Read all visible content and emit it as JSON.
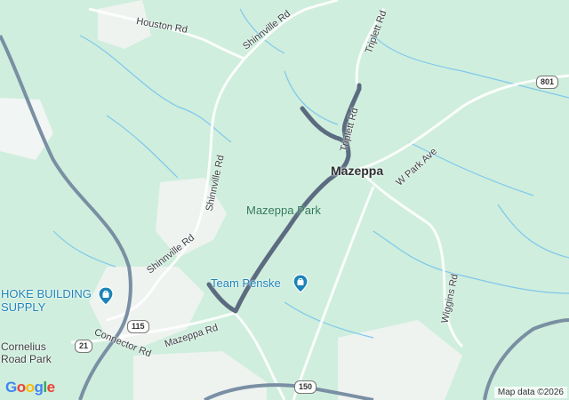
{
  "map": {
    "places": {
      "mazeppa": "Mazeppa",
      "mazeppa_park": "Mazeppa Park",
      "cornelius_road_park": "Cornelius Road Park"
    },
    "pois": {
      "team_penske": "Team Penske",
      "hoke_building_supply": "HOKE BUILDING SUPPLY"
    },
    "roads": {
      "houston_rd": "Houston Rd",
      "shinnville_rd_top": "Shinnville Rd",
      "triplett_rd_top": "Triplett Rd",
      "triplett_rd_mid": "Triplett Rd",
      "shinnville_rd_mid": "Shinnville Rd",
      "shinnville_rd_low": "Shinnville Rd",
      "w_park_ave": "W Park Ave",
      "wiggins_rd": "Wiggins Rd",
      "mazeppa_rd": "Mazeppa Rd",
      "connector_rd": "Connector Rd"
    },
    "shields": {
      "route_801": "801",
      "route_115": "115",
      "route_21": "21",
      "route_150": "150"
    },
    "colors": {
      "land": "#cfeedd",
      "route": "#5b6b80",
      "water": "#7ec8ec",
      "highway": "#7a8fa3",
      "poi": "#1b84b8",
      "park_text": "#2f7a55"
    },
    "branding": {
      "logo": "Google",
      "attribution": "Map data ©2026"
    }
  }
}
